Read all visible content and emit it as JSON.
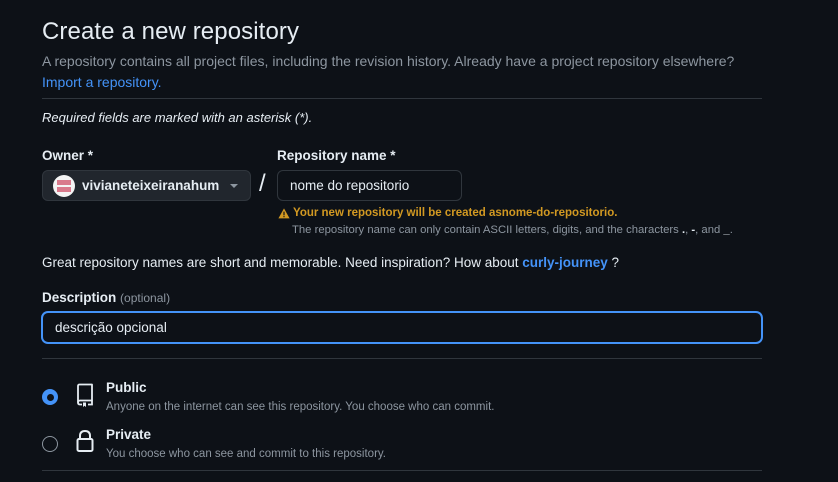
{
  "header": {
    "title": "Create a new repository",
    "intro_text": "A repository contains all project files, including the revision history. Already have a project repository elsewhere?",
    "import_link": "Import a repository."
  },
  "form": {
    "required_note": "Required fields are marked with an asterisk (*).",
    "owner": {
      "label": "Owner *",
      "value": "vivianeteixeiranahum"
    },
    "separator": "/",
    "repo_name": {
      "label": "Repository name *",
      "value": "nome do repositorio"
    },
    "warning": {
      "prefix": "Your new repository will be created as ",
      "name": "nome-do-repositorio",
      "suffix": ".",
      "detail_prefix": "The repository name can only contain ASCII letters, digits, and the characters ",
      "chars": ".",
      "chars2": "-",
      "detail_and": ", and ",
      "chars3": "_",
      "detail_end": "."
    },
    "inspiration": {
      "text": "Great repository names are short and memorable. Need inspiration? How about ",
      "suggestion": "curly-journey",
      "suffix": " ?"
    },
    "description": {
      "label": "Description",
      "optional": "(optional)",
      "value": "descrição opcional"
    },
    "visibility": [
      {
        "title": "Public",
        "desc": "Anyone on the internet can see this repository. You choose who can commit.",
        "checked": true,
        "icon": "repo-icon"
      },
      {
        "title": "Private",
        "desc": "You choose who can see and commit to this repository.",
        "checked": false,
        "icon": "lock-icon"
      }
    ]
  },
  "colors": {
    "background": "#0d1117",
    "accent": "#4493f8",
    "warning": "#d29922",
    "muted": "#8d96a0"
  }
}
